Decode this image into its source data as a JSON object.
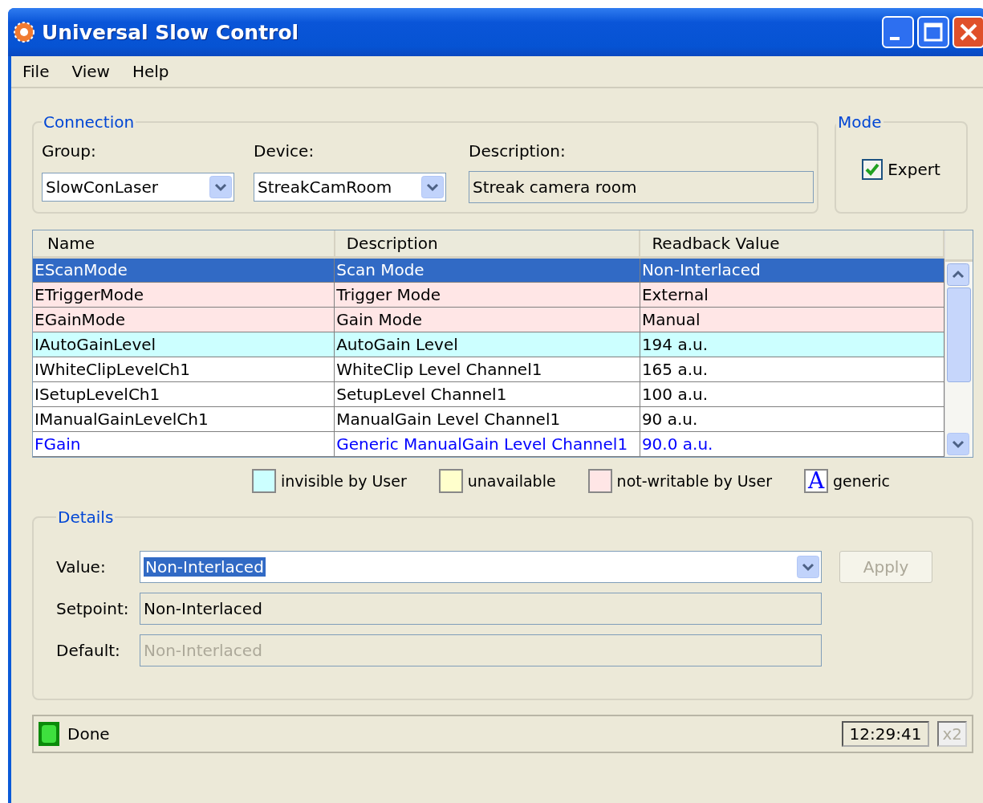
{
  "window": {
    "title": "Universal Slow Control"
  },
  "menu": [
    {
      "label": "File"
    },
    {
      "label": "View"
    },
    {
      "label": "Help"
    }
  ],
  "connection": {
    "title": "Connection",
    "group_label": "Group:",
    "group_value": "SlowConLaser",
    "device_label": "Device:",
    "device_value": "StreakCamRoom",
    "description_label": "Description:",
    "description_value": "Streak camera room"
  },
  "mode": {
    "title": "Mode",
    "expert": {
      "label": "Expert",
      "checked": true
    }
  },
  "table": {
    "columns": [
      "Name",
      "Description",
      "Readback Value"
    ],
    "rows": [
      {
        "kind": "normal",
        "selected": true,
        "cells": [
          "EScanMode",
          "Scan Mode",
          "Non-Interlaced"
        ]
      },
      {
        "kind": "not-writable",
        "selected": false,
        "cells": [
          "ETriggerMode",
          "Trigger Mode",
          "External"
        ]
      },
      {
        "kind": "not-writable",
        "selected": false,
        "cells": [
          "EGainMode",
          "Gain Mode",
          "Manual"
        ]
      },
      {
        "kind": "invisible",
        "selected": false,
        "cells": [
          "IAutoGainLevel",
          "AutoGain Level",
          "194 a.u."
        ]
      },
      {
        "kind": "normal",
        "selected": false,
        "cells": [
          "IWhiteClipLevelCh1",
          "WhiteClip Level Channel1",
          "165 a.u."
        ]
      },
      {
        "kind": "normal",
        "selected": false,
        "cells": [
          "ISetupLevelCh1",
          "SetupLevel Channel1",
          "100 a.u."
        ]
      },
      {
        "kind": "normal",
        "selected": false,
        "cells": [
          "IManualGainLevelCh1",
          "ManualGain Level Channel1",
          "90 a.u."
        ]
      },
      {
        "kind": "generic",
        "selected": false,
        "cells": [
          "FGain",
          "Generic ManualGain Level Channel1",
          "90.0 a.u."
        ]
      }
    ]
  },
  "legend": [
    {
      "kind": "swatch",
      "color": "#ccffff",
      "label": "invisible by User"
    },
    {
      "kind": "swatch",
      "color": "#ffffcc",
      "label": "unavailable"
    },
    {
      "kind": "swatch",
      "color": "#ffe6e6",
      "label": "not-writable by User"
    },
    {
      "kind": "glyph",
      "glyph": "A",
      "label": "generic"
    }
  ],
  "details": {
    "title": "Details",
    "value": {
      "label": "Value:",
      "value": "Non-Interlaced"
    },
    "apply": {
      "label": "Apply",
      "disabled": true
    },
    "setpoint": {
      "label": "Setpoint:",
      "value": "Non-Interlaced",
      "disabled": false
    },
    "default": {
      "label": "Default:",
      "value": "Non-Interlaced",
      "disabled": true
    }
  },
  "status_bar": {
    "text": "Done",
    "time": "12:29:41",
    "multiplier": {
      "label": "x2",
      "disabled": true
    }
  }
}
